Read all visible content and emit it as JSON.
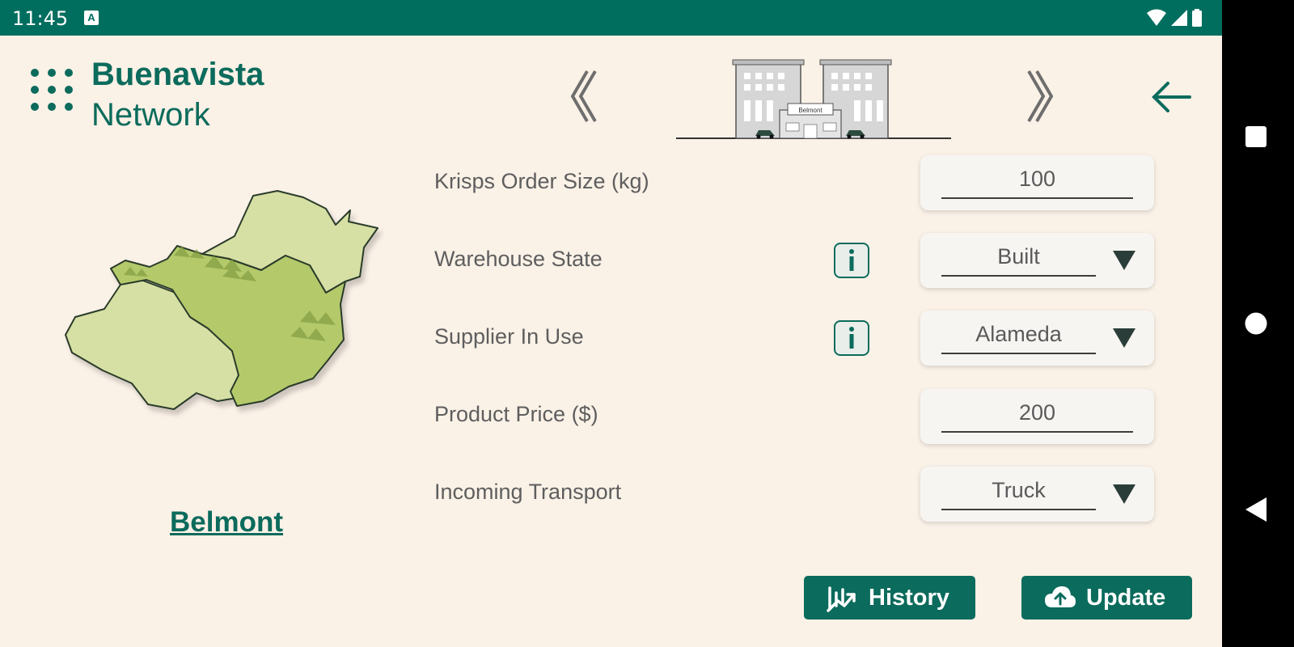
{
  "status_bar": {
    "time": "11:45",
    "notification_icon": "A",
    "icons": [
      "wifi-icon",
      "signal-icon",
      "battery-icon"
    ]
  },
  "brand": {
    "line1": "Buenavista",
    "line2": "Network"
  },
  "header": {
    "building_sign": "Belmont"
  },
  "region": {
    "name": "Belmont"
  },
  "form": {
    "rows": [
      {
        "label": "Krisps Order Size (kg)",
        "value": "100",
        "type": "input",
        "info": false
      },
      {
        "label": "Warehouse State",
        "value": "Built",
        "type": "dropdown",
        "info": true
      },
      {
        "label": "Supplier In Use",
        "value": "Alameda",
        "type": "dropdown",
        "info": true
      },
      {
        "label": "Product Price ($)",
        "value": "200",
        "type": "input",
        "info": false
      },
      {
        "label": "Incoming Transport",
        "value": "Truck",
        "type": "dropdown",
        "info": false
      }
    ]
  },
  "buttons": {
    "history": "History",
    "update": "Update"
  },
  "colors": {
    "primary": "#0b6b5c",
    "status_bar": "#006e5f",
    "background": "#faf1e7",
    "map_light": "#d7e0a4",
    "map_dark": "#b4c96b"
  }
}
